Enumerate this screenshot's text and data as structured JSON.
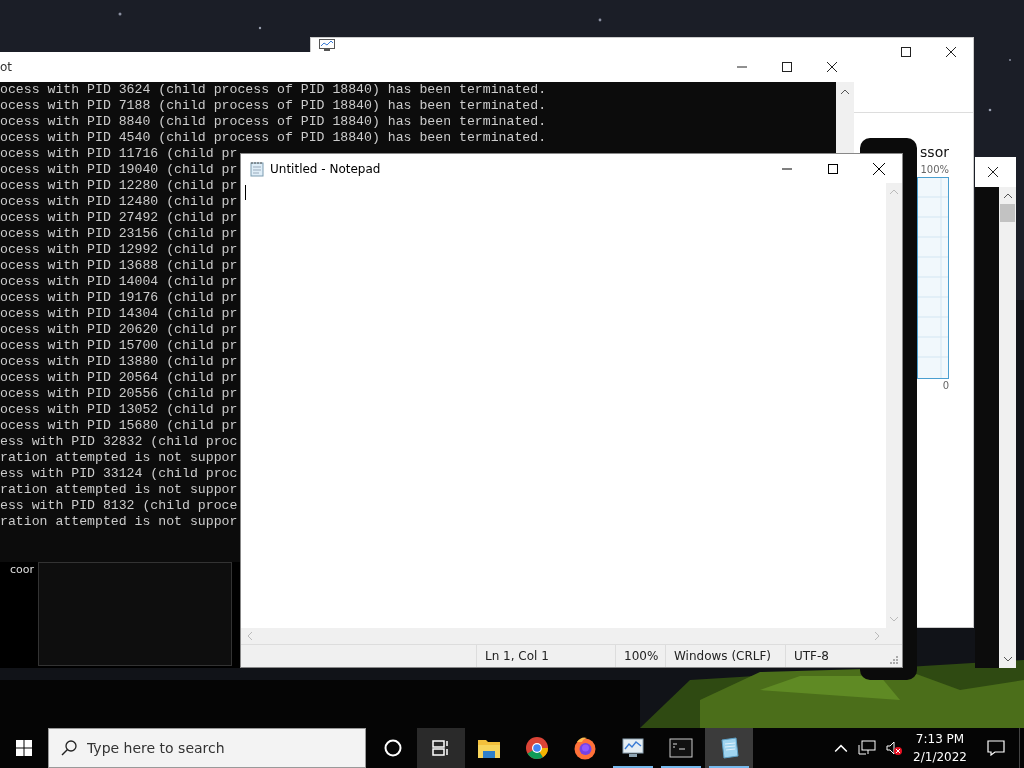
{
  "task_manager": {
    "heading": "ssor",
    "axis_max": "100%",
    "axis_min": "0"
  },
  "console_window": {
    "title": "ot",
    "lines": [
      "ocess with PID 3624 (child process of PID 18840) has been terminated.",
      "ocess with PID 7188 (child process of PID 18840) has been terminated.",
      "ocess with PID 8840 (child process of PID 18840) has been terminated.",
      "ocess with PID 4540 (child process of PID 18840) has been terminated.",
      "ocess with PID 11716 (child pr",
      "ocess with PID 19040 (child pr",
      "ocess with PID 12280 (child pr",
      "ocess with PID 12480 (child pr",
      "ocess with PID 27492 (child pr",
      "ocess with PID 23156 (child pr",
      "ocess with PID 12992 (child pr",
      "ocess with PID 13688 (child pr",
      "ocess with PID 14004 (child pr",
      "ocess with PID 19176 (child pr",
      "ocess with PID 14304 (child pr",
      "ocess with PID 20620 (child pr",
      "ocess with PID 15700 (child pr",
      "ocess with PID 13880 (child pr",
      "ocess with PID 20564 (child pr",
      "ocess with PID 20556 (child pr",
      "ocess with PID 13052 (child pr",
      "ocess with PID 15680 (child pr",
      "ess with PID 32832 (child proc",
      "ration attempted is not suppor",
      "ess with PID 33124 (child proc",
      "ration attempted is not suppor",
      "ess with PID 8132 (child proce",
      "ration attempted is not suppor"
    ]
  },
  "bottom_window": {
    "text": "coor"
  },
  "notepad": {
    "title": "Untitled - Notepad",
    "status_bar": [
      "Ln 1, Col 1",
      "100%",
      "Windows (CRLF)",
      "UTF-8"
    ]
  },
  "taskbar": {
    "search": {
      "placeholder": "Type here to search"
    },
    "task_view": {
      "highlighted": true
    },
    "apps": [
      {
        "kind": "folder",
        "running": false,
        "selected": false
      },
      {
        "kind": "chrome",
        "running": false,
        "selected": false
      },
      {
        "kind": "firefox",
        "running": false,
        "selected": false
      },
      {
        "kind": "monitor",
        "running": true,
        "selected": false
      },
      {
        "kind": "terminal",
        "running": true,
        "selected": false
      },
      {
        "kind": "notepad",
        "running": true,
        "selected": true
      }
    ],
    "tray": {
      "muted": true
    },
    "clock": {
      "time": "7:13 PM",
      "date": "2/1/2022"
    }
  }
}
